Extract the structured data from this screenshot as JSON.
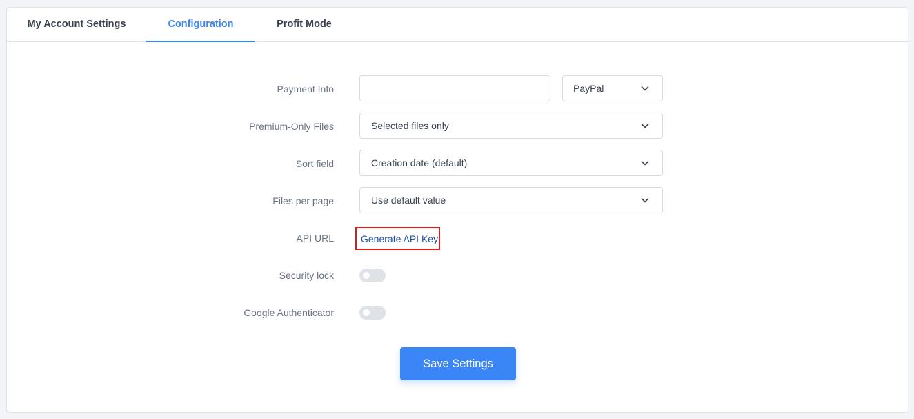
{
  "tabs": [
    {
      "label": "My Account Settings",
      "active": false
    },
    {
      "label": "Configuration",
      "active": true
    },
    {
      "label": "Profit Mode",
      "active": false
    }
  ],
  "form": {
    "payment_info": {
      "label": "Payment Info",
      "value": "",
      "method": "PayPal"
    },
    "premium_only": {
      "label": "Premium-Only Files",
      "value": "Selected files only"
    },
    "sort_field": {
      "label": "Sort field",
      "value": "Creation date (default)"
    },
    "files_per_page": {
      "label": "Files per page",
      "value": "Use default value"
    },
    "api_url": {
      "label": "API URL",
      "link": "Generate API Key"
    },
    "security_lock": {
      "label": "Security lock",
      "enabled": false
    },
    "google_auth": {
      "label": "Google Authenticator",
      "enabled": false
    }
  },
  "actions": {
    "save_label": "Save Settings"
  },
  "colors": {
    "accent": "#3a86f7",
    "highlight_border": "#e01a1a",
    "link": "#1e4fa8"
  }
}
